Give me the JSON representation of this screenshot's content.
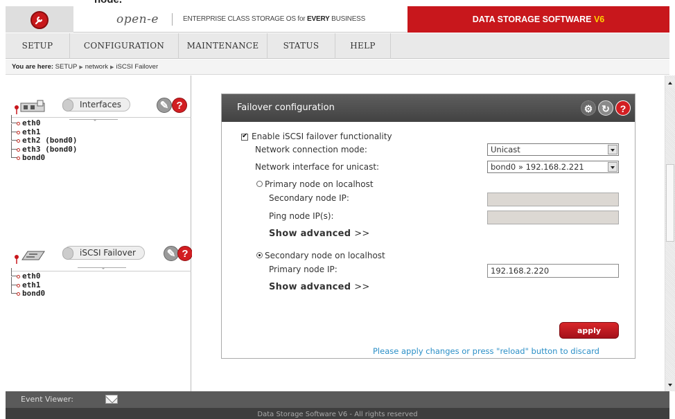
{
  "top_fragment": "node.",
  "header": {
    "brand": "open-e",
    "tagline_prefix": "ENTERPRISE CLASS STORAGE OS for ",
    "tagline_bold": "EVERY",
    "tagline_suffix": " BUSINESS",
    "product": "DATA STORAGE SOFTWARE ",
    "product_version": "V6"
  },
  "nav": {
    "items": [
      {
        "label": "SETUP"
      },
      {
        "label": "CONFIGURATION"
      },
      {
        "label": "MAINTENANCE"
      },
      {
        "label": "STATUS"
      },
      {
        "label": "HELP"
      }
    ]
  },
  "breadcrumb": {
    "prefix": "You are here:",
    "items": [
      "SETUP",
      "network",
      "iSCSI Failover"
    ]
  },
  "left": {
    "interfaces": {
      "title": "Interfaces",
      "items": [
        "eth0",
        "eth1",
        "eth2 (bond0)",
        "eth3 (bond0)",
        "bond0"
      ]
    },
    "failover": {
      "title": "iSCSI Failover",
      "items": [
        "eth0",
        "eth1",
        "bond0"
      ]
    }
  },
  "main": {
    "title": "Failover configuration",
    "enable_label": "Enable iSCSI failover functionality",
    "enable_checked": true,
    "conn_mode_label": "Network connection mode:",
    "conn_mode_value": "Unicast",
    "iface_label": "Network interface for unicast:",
    "iface_value": "bond0 » 192.168.2.221",
    "primary_radio_label": "Primary node on localhost",
    "secondary_ip_label": "Secondary node IP:",
    "secondary_ip_value": "",
    "ping_label": "Ping node IP(s):",
    "ping_value": "",
    "show_advanced": "Show advanced",
    "show_advanced_arrows": ">>",
    "secondary_radio_label": "Secondary node on localhost",
    "primary_ip_label": "Primary node IP:",
    "primary_ip_value": "192.168.2.220",
    "apply": "apply",
    "note": "Please apply changes or press \"reload\" button to discard"
  },
  "event_viewer": "Event Viewer:",
  "footer": "Data Storage Software V6 - All rights reserved",
  "colors": {
    "brand_red": "#c8171c",
    "accent_yellow": "#ffd200",
    "link_blue": "#2b8fc7",
    "header_dark": "#4a4a4a"
  },
  "icons": [
    "wrench-icon",
    "help-icon",
    "refresh-icon",
    "settings-icon",
    "network-card-icon",
    "failover-icon",
    "mail-icon"
  ]
}
